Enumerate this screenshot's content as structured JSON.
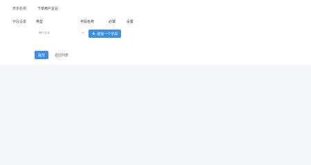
{
  "form": {
    "name_label": "表单名称",
    "name_value": "下单用户企业"
  },
  "fields": {
    "section_label": "字段设置",
    "columns": {
      "type": "类型",
      "name": "字段名称",
      "required": "必填",
      "settings": "设置"
    },
    "type_select": {
      "placeholder": "单行文本"
    },
    "add_button": {
      "icon": "plus-icon",
      "label": "增加一个字段"
    }
  },
  "actions": {
    "submit_label": "提交",
    "back_label": "返回列表"
  },
  "colors": {
    "primary": "#3a8ee6",
    "background": "#f5f6f7"
  }
}
